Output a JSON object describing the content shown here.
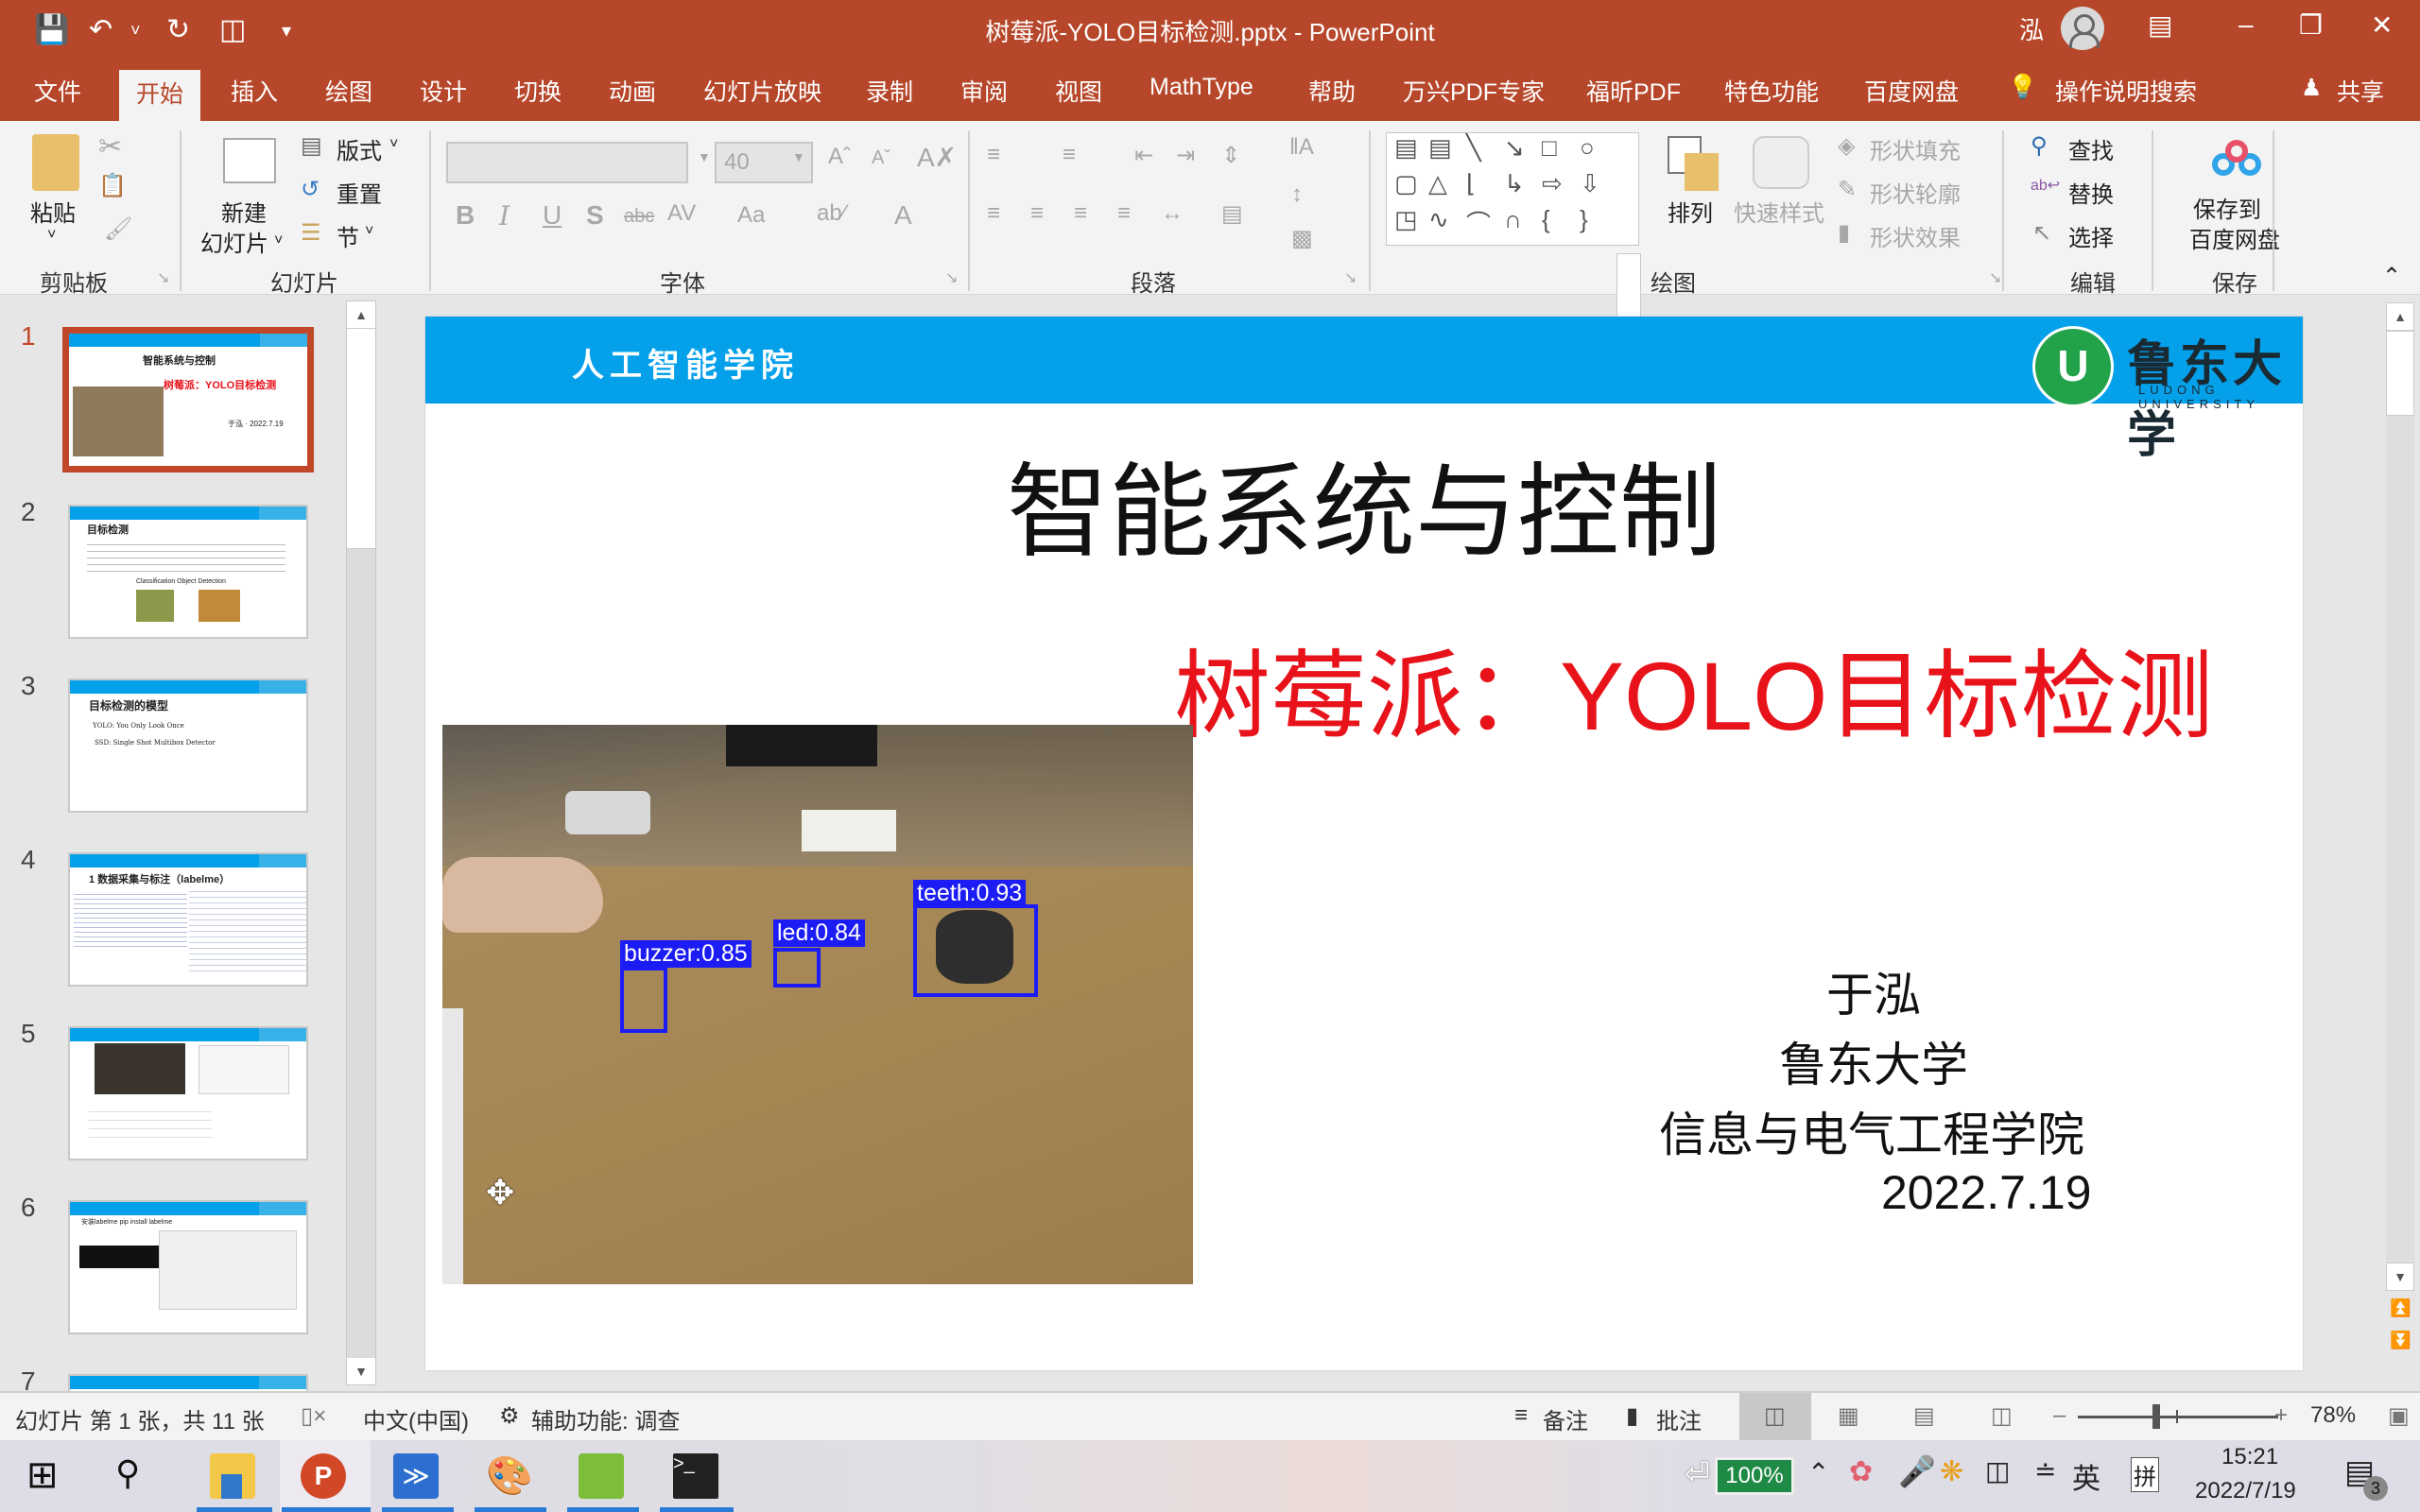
{
  "titlebar": {
    "doc_title": "树莓派-YOLO目标检测.pptx  -  PowerPoint",
    "user_name": "泓",
    "quick_access": [
      "save-icon",
      "undo-icon",
      "redo-icon",
      "start-from-beginning-icon",
      "customize-icon"
    ]
  },
  "menu_tabs": [
    "文件",
    "开始",
    "插入",
    "绘图",
    "设计",
    "切换",
    "动画",
    "幻灯片放映",
    "录制",
    "审阅",
    "视图",
    "MathType",
    "帮助",
    "万兴PDF专家",
    "福昕PDF",
    "特色功能",
    "百度网盘"
  ],
  "active_tab": "开始",
  "tell_me": "操作说明搜索",
  "share": "共享",
  "ribbon": {
    "clipboard": {
      "paste": "粘贴",
      "label": "剪贴板"
    },
    "slides": {
      "new_slide_line1": "新建",
      "new_slide_line2": "幻灯片",
      "layout": "版式",
      "reset": "重置",
      "section": "节",
      "label": "幻灯片"
    },
    "font": {
      "font_name": "",
      "font_size": "40",
      "label": "字体"
    },
    "paragraph": {
      "label": "段落"
    },
    "drawing": {
      "arrange": "排列",
      "quick_styles": "快速样式",
      "shape_fill": "形状填充",
      "shape_outline": "形状轮廓",
      "shape_effects": "形状效果",
      "label": "绘图"
    },
    "editing": {
      "find": "查找",
      "replace": "替换",
      "select": "选择",
      "label": "编辑"
    },
    "save": {
      "line1": "保存到",
      "line2": "百度网盘",
      "label": "保存"
    }
  },
  "thumbnails": [
    {
      "num": "1",
      "title": "智能系统与控制",
      "subtitle": "树莓派：YOLO目标检测"
    },
    {
      "num": "2",
      "title": "目标检测",
      "subtitle": "Classification   Object Detection"
    },
    {
      "num": "3",
      "title": "目标检测的模型",
      "subtitle": "YOLO: You Only Look Once"
    },
    {
      "num": "4",
      "title": "1 数据采集与标注（labelme）",
      "subtitle": ""
    },
    {
      "num": "5",
      "title": "",
      "subtitle": ""
    },
    {
      "num": "6",
      "title": "安装labelme  pip install labelme",
      "subtitle": ""
    },
    {
      "num": "7",
      "title": "",
      "subtitle": ""
    }
  ],
  "slide": {
    "header_school": "人工智能学院",
    "university_cn": "鲁东大学",
    "university_en": "LUDONG UNIVERSITY",
    "title": "智能系统与控制",
    "subtitle": "树莓派：YOLO目标检测",
    "author": "于泓",
    "university": "鲁东大学",
    "school": "信息与电气工程学院",
    "date": "2022.7.19",
    "detections": [
      {
        "label": "buzzer:0.85"
      },
      {
        "label": "led:0.84"
      },
      {
        "label": "teeth:0.93"
      }
    ]
  },
  "statusbar": {
    "slide_info": "幻灯片 第 1 张，共 11 张",
    "language": "中文(中国)",
    "accessibility": "辅助功能: 调查",
    "notes": "备注",
    "comments": "批注",
    "zoom": "78%",
    "zoom_fraction": 0.39
  },
  "taskbar": {
    "battery": "100%",
    "ime_lang": "英",
    "ime_mode": "拼",
    "time": "15:21",
    "date": "2022/7/19",
    "notifications": "3"
  }
}
